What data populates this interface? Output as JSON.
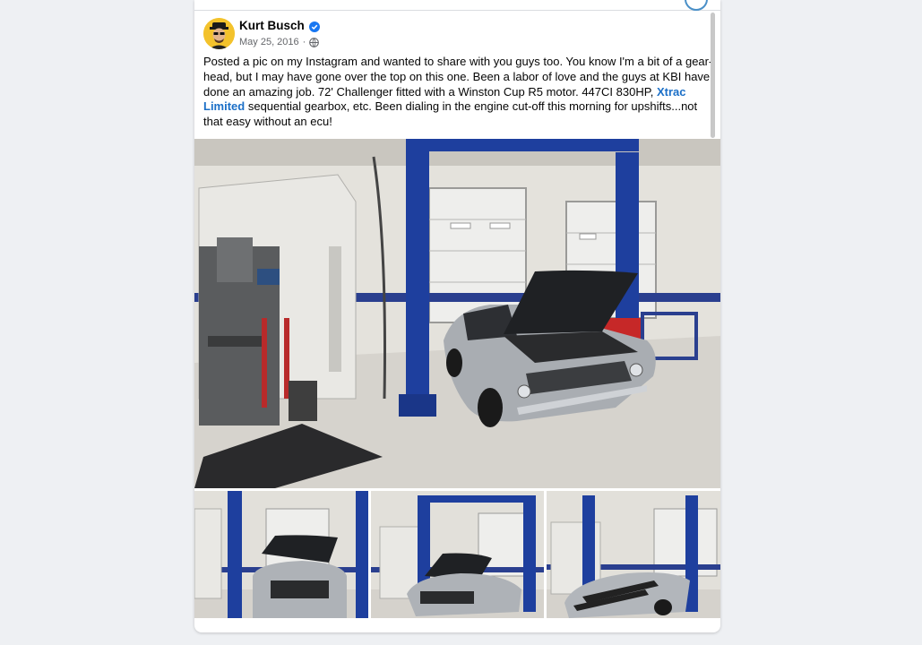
{
  "post": {
    "author": "Kurt Busch",
    "date": "May 25, 2016",
    "separator": "·",
    "text_parts": {
      "before_link": "Posted a pic on my Instagram and wanted to share with you guys too.  You know I'm a bit of a gear-head, but I may have gone over the top on this one. Been a labor of love and the guys at KBI have done an amazing job. 72' Challenger fitted with a Winston Cup R5 motor.  447CI 830HP, ",
      "link": "Xtrac Limited",
      "after_link": " sequential gearbox, etc. Been dialing in the engine cut-off this morning for upshifts...not that easy without an ecu!"
    }
  },
  "icons": {
    "verified": "verified-badge-icon",
    "audience": "globe-icon"
  },
  "colors": {
    "background": "#eef0f3",
    "link": "#1b6fc7",
    "verified": "#1877f2",
    "meta": "#65676b",
    "lift_blue": "#1e3f9e"
  },
  "photos": {
    "main": "Garage with a silver 1972 Dodge Challenger, hood up, on a blue two-post lift",
    "thumbs": [
      "Challenger front view, hood open",
      "Challenger three-quarter view, hood open",
      "Challenger with hood closed, black stripes"
    ]
  }
}
